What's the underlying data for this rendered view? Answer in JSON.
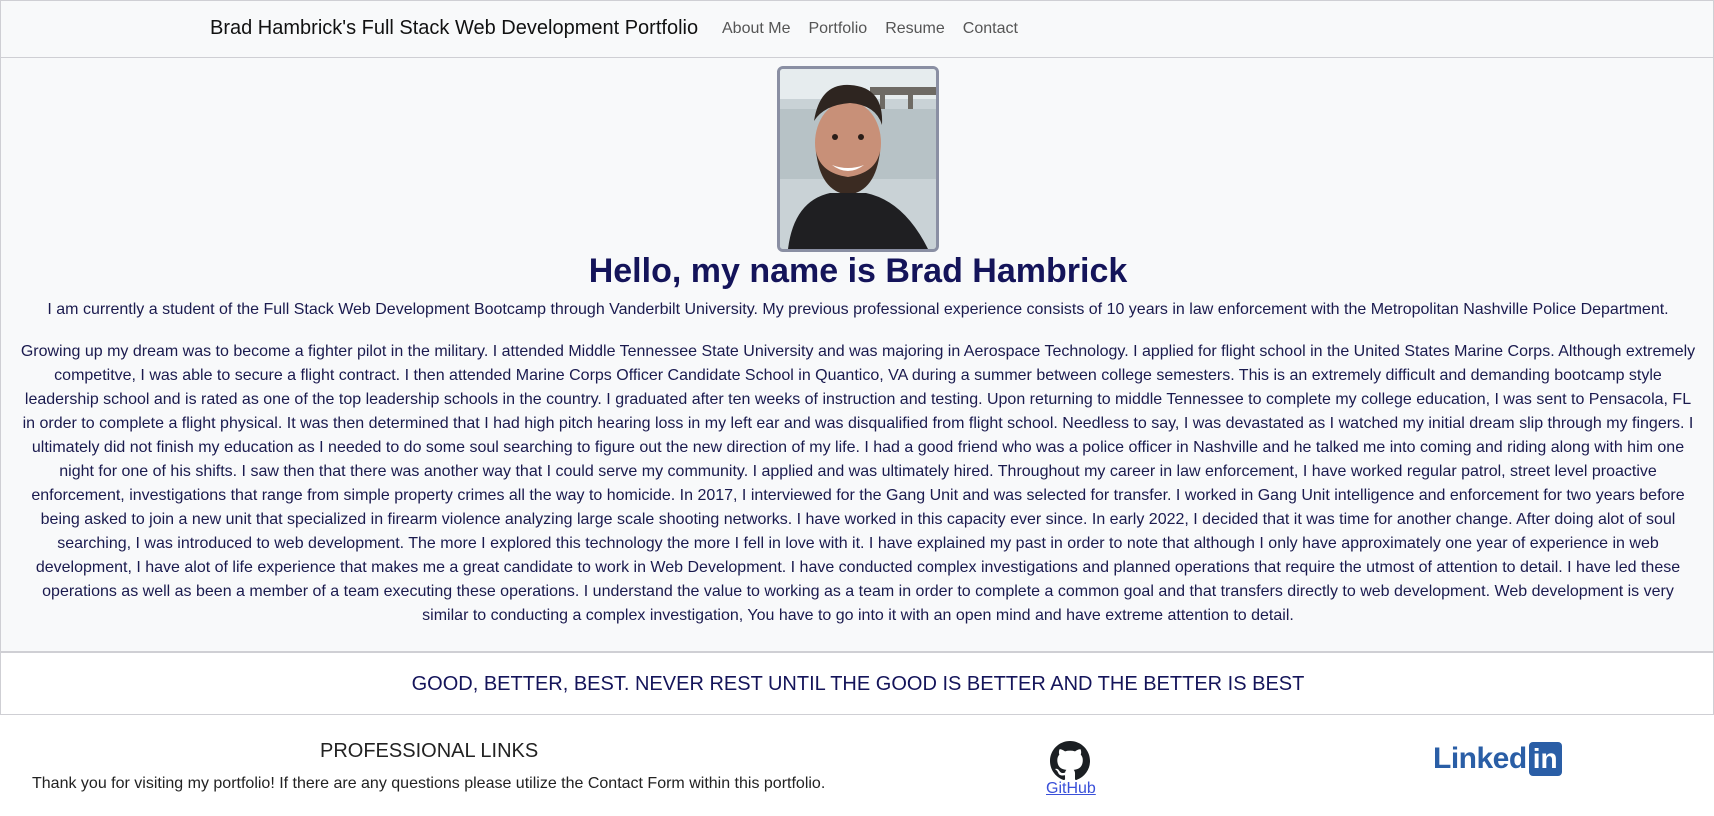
{
  "navbar": {
    "brand": "Brad Hambrick's Full Stack Web Development Portfolio",
    "links": [
      "About Me",
      "Portfolio",
      "Resume",
      "Contact"
    ]
  },
  "about": {
    "avatar_icon": "profile-photo",
    "heading": "Hello, my name is Brad Hambrick",
    "intro": "I am currently a student of the Full Stack Web Development Bootcamp through Vanderbilt University. My previous professional experience consists of 10 years in law enforcement with the Metropolitan Nashville Police Department.",
    "story": "Growing up my dream was to become a fighter pilot in the military. I attended Middle Tennessee State University and was majoring in Aerospace Technology. I applied for flight school in the United States Marine Corps. Although extremely competitve, I was able to secure a flight contract. I then attended Marine Corps Officer Candidate School in Quantico, VA during a summer between college semesters. This is an extremely difficult and demanding bootcamp style leadership school and is rated as one of the top leadership schools in the country. I graduated after ten weeks of instruction and testing. Upon returning to middle Tennessee to complete my college education, I was sent to Pensacola, FL in order to complete a flight physical. It was then determined that I had high pitch hearing loss in my left ear and was disqualified from flight school. Needless to say, I was devastated as I watched my initial dream slip through my fingers. I ultimately did not finish my education as I needed to do some soul searching to figure out the new direction of my life. I had a good friend who was a police officer in Nashville and he talked me into coming and riding along with him one night for one of his shifts. I saw then that there was another way that I could serve my community. I applied and was ultimately hired. Throughout my career in law enforcement, I have worked regular patrol, street level proactive enforcement, investigations that range from simple property crimes all the way to homicide. In 2017, I interviewed for the Gang Unit and was selected for transfer. I worked in Gang Unit intelligence and enforcement for two years before being asked to join a new unit that specialized in firearm violence analyzing large scale shooting networks. I have worked in this capacity ever since. In early 2022, I decided that it was time for another change. After doing alot of soul searching, I was introduced to web development. The more I explored this technology the more I fell in love with it. I have explained my past in order to note that although I only have approximately one year of experience in web development, I have alot of life experience that makes me a great candidate to work in Web Development. I have conducted complex investigations and planned operations that require the utmost of attention to detail. I have led these operations as well as been a member of a team executing these operations. I understand the value to working as a team in order to complete a common goal and that transfers directly to web development. Web development is very similar to conducting a complex investigation, You have to go into it with an open mind and have extreme attention to detail."
  },
  "motto": "GOOD, BETTER, BEST. NEVER REST UNTIL THE GOOD IS BETTER AND THE BETTER IS BEST",
  "footer": {
    "title": "PROFESSIONAL LINKS",
    "thanks": "Thank you for visiting my portfolio! If there are any questions please utilize the Contact Form within this portfolio.",
    "github_label": "GitHub",
    "github_icon": "github-icon",
    "linkedin_text": "Linked",
    "linkedin_in": "in",
    "linkedin_color": "#2a5ea6"
  }
}
